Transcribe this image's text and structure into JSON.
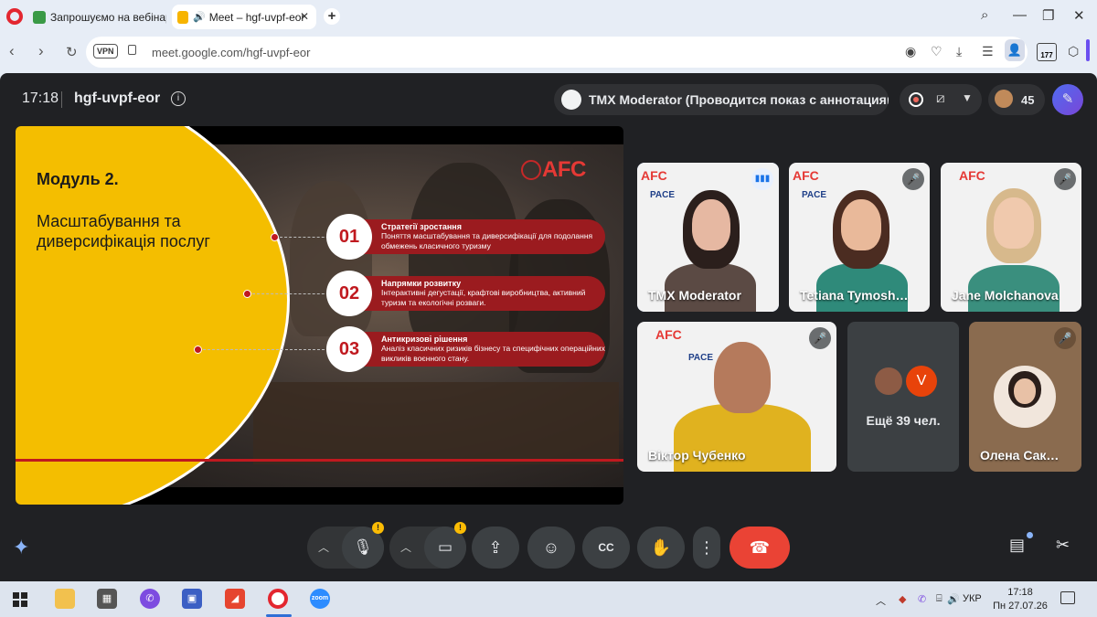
{
  "browser": {
    "tabs": [
      {
        "label": "Запрошуємо на вебінар",
        "active": false
      },
      {
        "label": "Meet – hgf-uvpf-eor",
        "active": true
      }
    ],
    "address": "meet.google.com/hgf-uvpf-eor",
    "vpn_label": "VPN",
    "extension_badge": "177"
  },
  "meet": {
    "time": "17:18",
    "meeting_code": "hgf-uvpf-eor",
    "presenter_status": "TMX Moderator (Проводится показ с аннотациями)",
    "participant_count": "45",
    "more_participants": "Ещё 39 чел.",
    "more_avatar_letter": "V"
  },
  "slide": {
    "title": "Модуль 2.",
    "subtitle": "Масштабування та диверсифікація послуг",
    "logo_text": "AFC",
    "items": [
      {
        "num": "01",
        "title": "Стратегії зростання",
        "desc": "Поняття масштабування та диверсифікації для подолання обмежень класичного туризму"
      },
      {
        "num": "02",
        "title": "Напрямки розвитку",
        "desc": "Інтерактивні дегустації, крафтові виробництва, активний туризм та екологічні розваги."
      },
      {
        "num": "03",
        "title": "Антикризові рішення",
        "desc": "Аналіз класичних ризиків бізнесу та специфічних операційних викликів воєнного стану."
      }
    ]
  },
  "participants": [
    {
      "name": "TMX Moderator",
      "speaking": true
    },
    {
      "name": "Tetiana Tymosh…",
      "muted": true
    },
    {
      "name": "Jane Molchanova",
      "muted": true
    },
    {
      "name": "Віктор Чубенко",
      "muted": true
    },
    {
      "name": "Олена Сак…",
      "muted": true
    }
  ],
  "tile_labels": {
    "afc": "AFC",
    "pace": "PACE"
  },
  "taskbar": {
    "lang": "УКР",
    "time": "17:18",
    "date": "Пн 27.07.26",
    "zoom_label": "zoom"
  },
  "colors": {
    "meet_bg": "#202124",
    "slide_yellow": "#f4be00",
    "slide_red": "#9b1b1f",
    "end_call": "#ea4335",
    "accent": "#8ab4f8"
  }
}
